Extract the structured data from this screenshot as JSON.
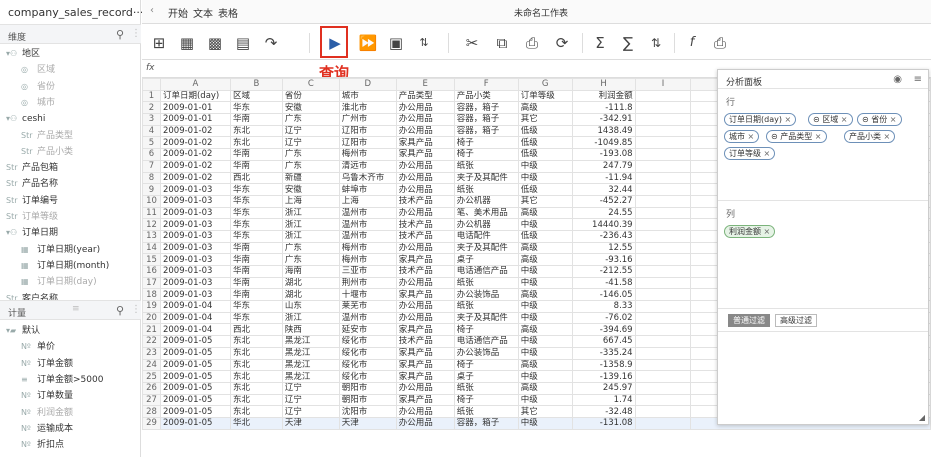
{
  "dataset": {
    "name": "company_sales_record···"
  },
  "dimensions": {
    "title": "维度",
    "items": [
      {
        "label": "地区",
        "kind": "hierarchy",
        "indent": 0,
        "style": "normal"
      },
      {
        "label": "区域",
        "kind": "geo",
        "indent": 1,
        "style": "muted"
      },
      {
        "label": "省份",
        "kind": "geo",
        "indent": 1,
        "style": "muted"
      },
      {
        "label": "城市",
        "kind": "geo",
        "indent": 1,
        "style": "muted"
      },
      {
        "label": "ceshi",
        "kind": "hierarchy",
        "indent": 0,
        "style": "normal"
      },
      {
        "label": "产品类型",
        "kind": "str",
        "indent": 1,
        "style": "muted"
      },
      {
        "label": "产品小类",
        "kind": "str",
        "indent": 1,
        "style": "muted"
      },
      {
        "label": "产品包箱",
        "kind": "str",
        "indent": 0,
        "style": "normal"
      },
      {
        "label": "产品名称",
        "kind": "str",
        "indent": 0,
        "style": "normal"
      },
      {
        "label": "订单编号",
        "kind": "str",
        "indent": 0,
        "style": "normal"
      },
      {
        "label": "订单等级",
        "kind": "str",
        "indent": 0,
        "style": "muted"
      },
      {
        "label": "订单日期",
        "kind": "hierarchy",
        "indent": 0,
        "style": "normal"
      },
      {
        "label": "订单日期(year)",
        "kind": "date",
        "indent": 1,
        "style": "normal"
      },
      {
        "label": "订单日期(month)",
        "kind": "date",
        "indent": 1,
        "style": "normal"
      },
      {
        "label": "订单日期(day)",
        "kind": "date",
        "indent": 1,
        "style": "muted"
      },
      {
        "label": "客户名称",
        "kind": "str",
        "indent": 0,
        "style": "normal"
      }
    ]
  },
  "measures": {
    "title": "计量",
    "items": [
      {
        "label": "默认",
        "kind": "folder",
        "indent": 0,
        "style": "normal"
      },
      {
        "label": "单价",
        "kind": "num",
        "indent": 1,
        "style": "normal"
      },
      {
        "label": "订单金额",
        "kind": "num",
        "indent": 1,
        "style": "normal"
      },
      {
        "label": "订单金额>5000",
        "kind": "calc",
        "indent": 1,
        "style": "normal"
      },
      {
        "label": "订单数量",
        "kind": "num",
        "indent": 1,
        "style": "normal"
      },
      {
        "label": "利润金额",
        "kind": "num",
        "indent": 1,
        "style": "muted"
      },
      {
        "label": "运输成本",
        "kind": "num",
        "indent": 1,
        "style": "normal"
      },
      {
        "label": "折扣点",
        "kind": "num",
        "indent": 1,
        "style": "normal"
      }
    ]
  },
  "ribbon": {
    "tabs": [
      "开始",
      "文本",
      "表格"
    ],
    "workbook_title": "未命名工作表",
    "query_label": "查询"
  },
  "formula": {
    "fx": "fx"
  },
  "sheet": {
    "col_letters": [
      "",
      "A",
      "B",
      "C",
      "D",
      "E",
      "F",
      "G",
      "H",
      "I",
      "J"
    ],
    "header": [
      "订单日期(day)",
      "区域",
      "省份",
      "城市",
      "产品类型",
      "产品小类",
      "订单等级",
      "利润金额"
    ],
    "rows": [
      [
        "2009-01-01",
        "华东",
        "安徽",
        "淮北市",
        "办公用品",
        "容器，箱子",
        "高级",
        "-111.8"
      ],
      [
        "2009-01-01",
        "华南",
        "广东",
        "广州市",
        "办公用品",
        "容器，箱子",
        "其它",
        "-342.91"
      ],
      [
        "2009-01-02",
        "东北",
        "辽宁",
        "辽阳市",
        "办公用品",
        "容器，箱子",
        "低级",
        "1438.49"
      ],
      [
        "2009-01-02",
        "东北",
        "辽宁",
        "辽阳市",
        "家具产品",
        "椅子",
        "低级",
        "-1049.85"
      ],
      [
        "2009-01-02",
        "华南",
        "广东",
        "梅州市",
        "家具产品",
        "椅子",
        "低级",
        "-193.08"
      ],
      [
        "2009-01-02",
        "华南",
        "广东",
        "清远市",
        "办公用品",
        "纸张",
        "中级",
        "247.79"
      ],
      [
        "2009-01-02",
        "西北",
        "新疆",
        "乌鲁木齐市",
        "办公用品",
        "夹子及其配件",
        "中级",
        "-11.94"
      ],
      [
        "2009-01-03",
        "华东",
        "安徽",
        "蚌埠市",
        "办公用品",
        "纸张",
        "低级",
        "32.44"
      ],
      [
        "2009-01-03",
        "华东",
        "上海",
        "上海",
        "技术产品",
        "办公机器",
        "其它",
        "-452.27"
      ],
      [
        "2009-01-03",
        "华东",
        "浙江",
        "温州市",
        "办公用品",
        "笔、美术用品",
        "高级",
        "24.55"
      ],
      [
        "2009-01-03",
        "华东",
        "浙江",
        "温州市",
        "技术产品",
        "办公机器",
        "中级",
        "14440.39"
      ],
      [
        "2009-01-03",
        "华东",
        "浙江",
        "温州市",
        "技术产品",
        "电话配件",
        "低级",
        "-236.43"
      ],
      [
        "2009-01-03",
        "华南",
        "广东",
        "梅州市",
        "办公用品",
        "夹子及其配件",
        "高级",
        "12.55"
      ],
      [
        "2009-01-03",
        "华南",
        "广东",
        "梅州市",
        "家具产品",
        "桌子",
        "高级",
        "-93.16"
      ],
      [
        "2009-01-03",
        "华南",
        "海南",
        "三亚市",
        "技术产品",
        "电话通信产品",
        "中级",
        "-212.55"
      ],
      [
        "2009-01-03",
        "华南",
        "湖北",
        "荆州市",
        "办公用品",
        "纸张",
        "中级",
        "-41.58"
      ],
      [
        "2009-01-03",
        "华南",
        "湖北",
        "十堰市",
        "家具产品",
        "办公装饰品",
        "高级",
        "-146.05"
      ],
      [
        "2009-01-04",
        "华东",
        "山东",
        "莱芜市",
        "办公用品",
        "纸张",
        "中级",
        "8.33"
      ],
      [
        "2009-01-04",
        "华东",
        "浙江",
        "温州市",
        "办公用品",
        "夹子及其配件",
        "中级",
        "-76.02"
      ],
      [
        "2009-01-04",
        "西北",
        "陕西",
        "延安市",
        "家具产品",
        "椅子",
        "高级",
        "-394.69"
      ],
      [
        "2009-01-05",
        "东北",
        "黑龙江",
        "绥化市",
        "技术产品",
        "电话通信产品",
        "中级",
        "667.45"
      ],
      [
        "2009-01-05",
        "东北",
        "黑龙江",
        "绥化市",
        "家具产品",
        "办公装饰品",
        "中级",
        "-335.24"
      ],
      [
        "2009-01-05",
        "东北",
        "黑龙江",
        "绥化市",
        "家具产品",
        "椅子",
        "高级",
        "-1358.9"
      ],
      [
        "2009-01-05",
        "东北",
        "黑龙江",
        "绥化市",
        "家具产品",
        "桌子",
        "中级",
        "-139.16"
      ],
      [
        "2009-01-05",
        "东北",
        "辽宁",
        "朝阳市",
        "办公用品",
        "纸张",
        "高级",
        "245.97"
      ],
      [
        "2009-01-05",
        "东北",
        "辽宁",
        "朝阳市",
        "家具产品",
        "椅子",
        "中级",
        "1.74"
      ],
      [
        "2009-01-05",
        "东北",
        "辽宁",
        "沈阳市",
        "办公用品",
        "纸张",
        "其它",
        "-32.48"
      ],
      [
        "2009-01-05",
        "华北",
        "天津",
        "天津",
        "办公用品",
        "容器，箱子",
        "中级",
        "-131.08"
      ]
    ]
  },
  "analysis_panel": {
    "title": "分析面板",
    "rows_label": "行",
    "row_chips": [
      "订单日期(day)",
      "区域",
      "省份",
      "城市",
      "产品类型",
      "产品小类",
      "订单等级"
    ],
    "cols_label": "列",
    "col_chips": [
      "利润金额"
    ],
    "filter_tabs": [
      "普通过滤",
      "高级过滤"
    ],
    "remove_glyph": "×"
  }
}
